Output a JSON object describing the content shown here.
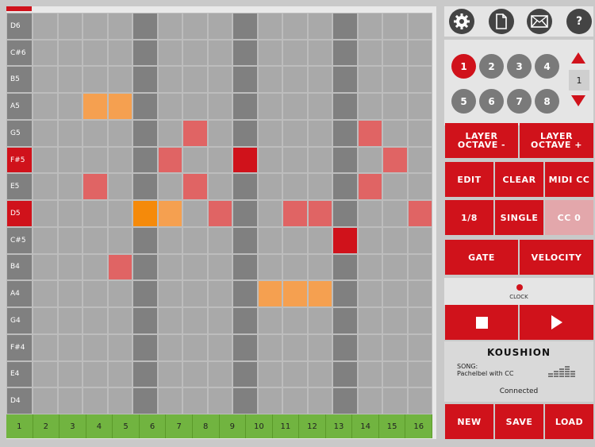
{
  "colors": {
    "accent": "#d0121b",
    "cell_empty": "#a9a9a9",
    "cell_dark": "#808080",
    "note_light_red": "#e06464",
    "note_orange": "#f5a050",
    "note_bright_orange": "#f58a0a",
    "step_green": "#71b440"
  },
  "grid": {
    "rows": [
      "D6",
      "C#6",
      "B5",
      "A5",
      "G5",
      "F#5",
      "E5",
      "D5",
      "C#5",
      "B4",
      "A4",
      "G4",
      "F#4",
      "E4",
      "D4"
    ],
    "active_rows": [
      "F#5",
      "D5"
    ],
    "dark_columns": [
      5,
      9,
      13
    ],
    "steps": [
      "1",
      "2",
      "3",
      "4",
      "5",
      "6",
      "7",
      "8",
      "9",
      "10",
      "11",
      "12",
      "13",
      "14",
      "15",
      "16"
    ],
    "notes": [
      {
        "row": "A5",
        "step": 3,
        "color": "note_orange"
      },
      {
        "row": "A5",
        "step": 4,
        "color": "note_orange"
      },
      {
        "row": "G5",
        "step": 7,
        "color": "note_light_red"
      },
      {
        "row": "G5",
        "step": 14,
        "color": "note_light_red"
      },
      {
        "row": "F#5",
        "step": 6,
        "color": "note_light_red"
      },
      {
        "row": "F#5",
        "step": 9,
        "color": "accent"
      },
      {
        "row": "F#5",
        "step": 15,
        "color": "note_light_red"
      },
      {
        "row": "E5",
        "step": 3,
        "color": "note_light_red"
      },
      {
        "row": "E5",
        "step": 7,
        "color": "note_light_red"
      },
      {
        "row": "E5",
        "step": 14,
        "color": "note_light_red"
      },
      {
        "row": "D5",
        "step": 5,
        "color": "note_bright_orange"
      },
      {
        "row": "D5",
        "step": 6,
        "color": "note_orange"
      },
      {
        "row": "D5",
        "step": 8,
        "color": "note_light_red"
      },
      {
        "row": "D5",
        "step": 11,
        "color": "note_light_red"
      },
      {
        "row": "D5",
        "step": 12,
        "color": "note_light_red"
      },
      {
        "row": "D5",
        "step": 16,
        "color": "note_light_red"
      },
      {
        "row": "C#5",
        "step": 13,
        "color": "accent"
      },
      {
        "row": "B4",
        "step": 4,
        "color": "note_light_red"
      },
      {
        "row": "A4",
        "step": 10,
        "color": "note_orange"
      },
      {
        "row": "A4",
        "step": 11,
        "color": "note_orange"
      },
      {
        "row": "A4",
        "step": 12,
        "color": "note_orange"
      }
    ]
  },
  "toolbar": {
    "icons": [
      "gear-icon",
      "document-icon",
      "mail-icon",
      "help-icon"
    ],
    "help_label": "?"
  },
  "patterns": {
    "labels": [
      "1",
      "2",
      "3",
      "4",
      "5",
      "6",
      "7",
      "8"
    ],
    "active": "1"
  },
  "octave": {
    "value": "1"
  },
  "layer": {
    "octave_minus": "LAYER OCTAVE -",
    "octave_plus": "LAYER OCTAVE +"
  },
  "controls": {
    "edit": "EDIT",
    "clear": "CLEAR",
    "midi_cc": "MIDI CC",
    "division": "1/8",
    "single": "SINGLE",
    "cc": "CC 0",
    "gate": "GATE",
    "velocity": "VELOCITY"
  },
  "clock": {
    "label": "CLOCK"
  },
  "transport": {
    "stop_icon": "stop-icon",
    "play_icon": "play-icon"
  },
  "device": {
    "name": "KOUSHION",
    "song_label": "SONG:",
    "song_name": "Pachelbel with CC",
    "status": "Connected"
  },
  "file": {
    "new": "NEW",
    "save": "SAVE",
    "load": "LOAD"
  }
}
